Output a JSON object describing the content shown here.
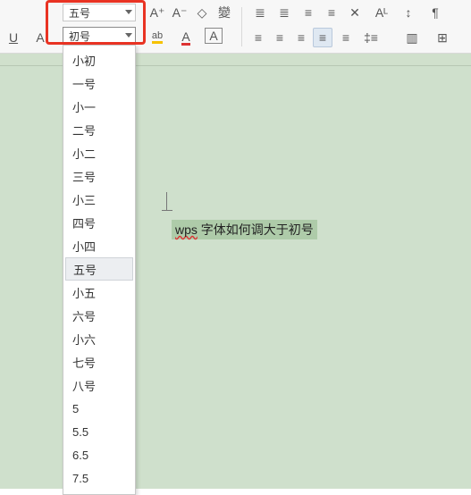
{
  "toolbar": {
    "row1": {
      "font_size_display": "五号",
      "btn_increase": "A⁺",
      "btn_decrease": "A⁻",
      "btn_clear_format": "◇",
      "btn_pinyin": "變",
      "btn_bullets": "≣",
      "btn_numbering": "≣",
      "btn_decrease_indent": "≡",
      "btn_increase_indent": "≡",
      "btn_settings": "✕",
      "btn_AL": "Aᴸ",
      "btn_sort": "↕",
      "btn_paragraph_mark": "¶"
    },
    "row2": {
      "btn_underline": "U",
      "btn_font_color": "A",
      "size_input_value": "初号",
      "btn_highlight": "ab",
      "btn_text_color": "A",
      "btn_border_char": "A",
      "btn_align_left": "≡",
      "btn_align_center": "≡",
      "btn_align_right": "≡",
      "btn_justify": "≡",
      "btn_distribute": "≡",
      "btn_line_spacing": "‡≡",
      "btn_shading": "▥",
      "btn_border": "⊞"
    }
  },
  "dropdown": {
    "items": [
      "小初",
      "一号",
      "小一",
      "二号",
      "小二",
      "三号",
      "小三",
      "四号",
      "小四",
      "五号",
      "小五",
      "六号",
      "小六",
      "七号",
      "八号",
      "5",
      "5.5",
      "6.5",
      "7.5"
    ],
    "selected_index": 9
  },
  "document": {
    "sample_text_prefix": "wps",
    "sample_text_rest": " 字体如何调大于初号"
  }
}
